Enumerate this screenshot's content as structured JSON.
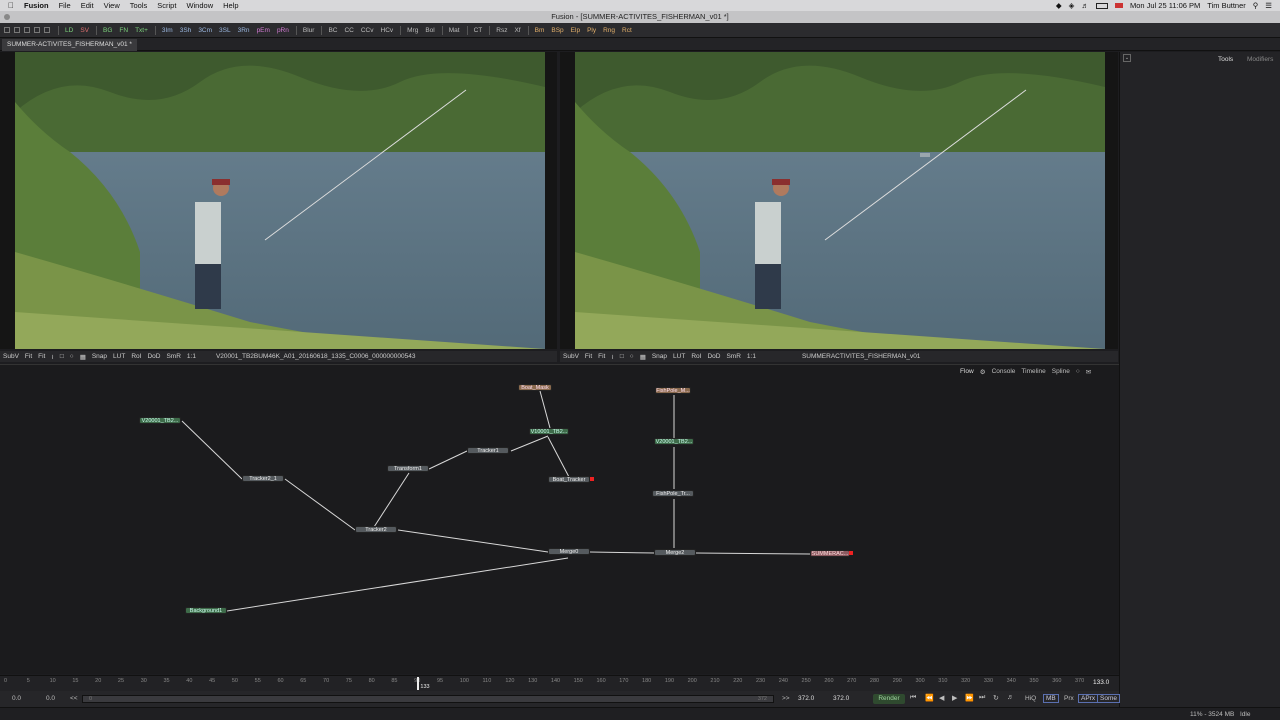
{
  "menubar": {
    "app": "Fusion",
    "items": [
      "File",
      "Edit",
      "View",
      "Tools",
      "Script",
      "Window",
      "Help"
    ],
    "clock": "Mon Jul 25  11:06 PM",
    "user": "Tim Buttner"
  },
  "window": {
    "title": "Fusion - [SUMMER-ACTIVITES_FISHERMAN_v01 *]"
  },
  "toolbar": {
    "items": [
      "LD",
      "SV",
      "BG",
      "FN",
      "Txt+",
      "3Im",
      "3Sh",
      "3Cm",
      "3SL",
      "3Rn",
      "pEm",
      "pRn",
      "Blur",
      "BC",
      "CC",
      "CCv",
      "HCv",
      "Mrg",
      "Bol",
      "Mat",
      "CT",
      "Rsz",
      "Xf",
      "Bm",
      "BSp",
      "Elp",
      "Ply",
      "Rng",
      "Rct"
    ]
  },
  "doc_tab": {
    "label": "SUMMER-ACTIVITES_FISHERMAN_v01 *"
  },
  "viewer_left": {
    "subv": "SubV",
    "fit": "Fit",
    "fit2": "Fit",
    "snap": "Snap",
    "lut": "LUT",
    "roi": "RoI",
    "dod": "DoD",
    "smr": "SmR",
    "ratio": "1:1",
    "clip": "V20001_TB2BUM46K_A01_20160618_1335_C0006_000000000543"
  },
  "viewer_right": {
    "subv": "SubV",
    "fit": "Fit",
    "fit2": "Fit",
    "snap": "Snap",
    "lut": "LUT",
    "roi": "RoI",
    "dod": "DoD",
    "smr": "SmR",
    "ratio": "1:1",
    "clip": "SUMMERACTIVITES_FISHERMAN_v01"
  },
  "right_panel": {
    "tab_tools": "Tools",
    "tab_modifiers": "Modifiers"
  },
  "flow_tabs": {
    "flow": "Flow",
    "console": "Console",
    "timeline": "Timeline",
    "spline": "Spline"
  },
  "nodes": {
    "loader1": "V20001_TB2...",
    "boat_mask": "Boat_Mask",
    "loader2": "V10001_TB2...",
    "tracker1": "Tracker1",
    "transform1": "Transform1",
    "boat_tracker": "Boat_Tracker",
    "tracker2_1": "Tracker2_1",
    "tracker2": "Tracker2",
    "merge0": "Merge0",
    "merge2": "Merge2",
    "fishpole_m": "FishPole_M...",
    "loader3": "V20001_TB2...",
    "fishpole_tr": "FishPole_Tr...",
    "saver": "SUMMERAC...",
    "background1": "Background1"
  },
  "timeline": {
    "ticks": [
      "0",
      "5",
      "10",
      "15",
      "20",
      "25",
      "30",
      "35",
      "40",
      "45",
      "50",
      "55",
      "60",
      "65",
      "70",
      "75",
      "80",
      "85",
      "90",
      "95",
      "100",
      "110",
      "120",
      "130",
      "140",
      "150",
      "160",
      "170",
      "180",
      "190",
      "200",
      "210",
      "220",
      "230",
      "240",
      "250",
      "260",
      "270",
      "280",
      "290",
      "300",
      "310",
      "320",
      "330",
      "340",
      "350",
      "360",
      "370"
    ],
    "current": "133",
    "end_display": "133.0",
    "current_fraction": 0.358
  },
  "transport": {
    "start": "0.0",
    "start2": "0.0",
    "range_start": "0",
    "range_end": "372",
    "end1": "372.0",
    "end2": "372.0",
    "render": "Render",
    "hiq": "HiQ",
    "mb": "MB",
    "prx": "Prx",
    "aprx": "APrx",
    "some": "Some"
  },
  "status": {
    "memory": "11% - 3524 MB",
    "state": "Idle"
  }
}
